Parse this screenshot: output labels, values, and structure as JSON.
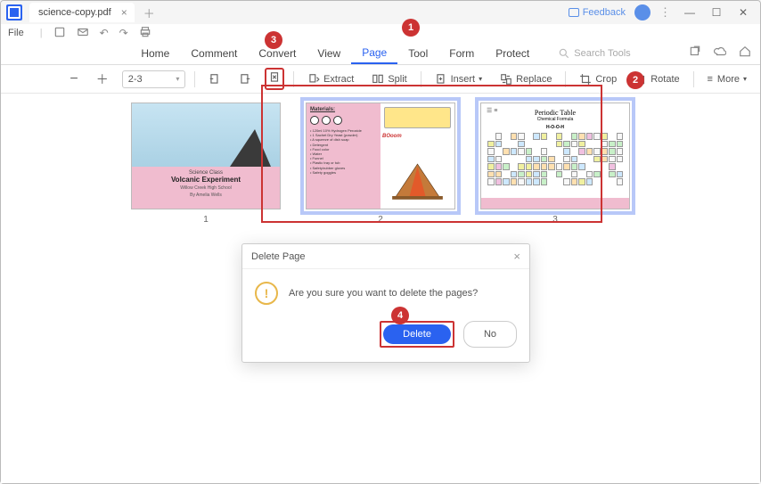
{
  "titlebar": {
    "tab_label": "science-copy.pdf",
    "feedback_label": "Feedback"
  },
  "filebar": {
    "file_label": "File"
  },
  "menu": {
    "items": [
      "Home",
      "Comment",
      "Convert",
      "View",
      "Page",
      "Tool",
      "Form",
      "Protect"
    ],
    "active_index": 4,
    "search_placeholder": "Search Tools"
  },
  "toolbar": {
    "page_range": "2-3",
    "extract": "Extract",
    "split": "Split",
    "insert": "Insert",
    "replace": "Replace",
    "crop": "Crop",
    "rotate": "Rotate",
    "more": "More"
  },
  "thumbs": {
    "page1": {
      "num": "1",
      "line1": "Science Class",
      "title": "Volcanic Experiment",
      "sub1": "Willow Creek High School",
      "sub2": "By Amelia Wells"
    },
    "page2": {
      "num": "2",
      "materials_title": "Materials:",
      "boom": "BOoom",
      "list": "• 120ml 10% Hydrogen Peroxide\n• 1 Sachet Dry Yeast (powder)\n• A squeeze of dish soap\n• Detergent\n• Food color\n• Water\n• Funnel\n• Plastic tray or tub\n• Safety/rubber gloves\n• Safety goggles"
    },
    "page3": {
      "num": "3",
      "title": "Periodic Table",
      "sub": "Chemical Formula",
      "hooh": "H-O-O-H"
    }
  },
  "dialog": {
    "title": "Delete Page",
    "message": "Are you sure you want to delete the pages?",
    "delete_btn": "Delete",
    "no_btn": "No"
  },
  "callouts": {
    "c1": "1",
    "c2": "2",
    "c3": "3",
    "c4": "4"
  }
}
